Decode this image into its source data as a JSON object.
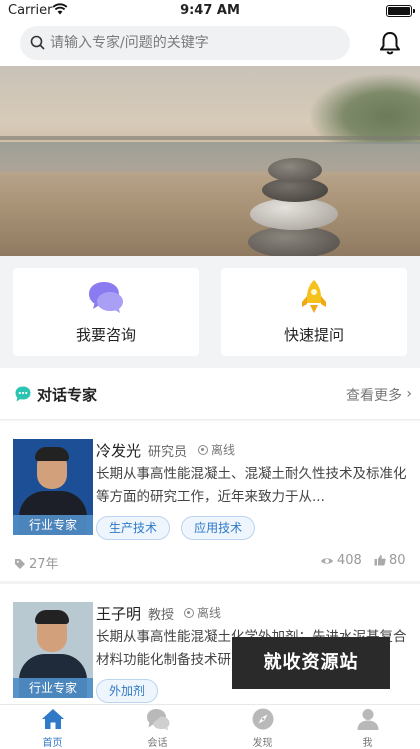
{
  "status_bar": {
    "carrier": "Carrier",
    "time": "9:47 AM"
  },
  "search": {
    "placeholder": "请输入专家/问题的关键字"
  },
  "banner": {
    "active_slide": 1
  },
  "actions": [
    {
      "label": "我要咨询",
      "icon": "chat-bubbles-icon"
    },
    {
      "label": "快速提问",
      "icon": "rocket-icon"
    }
  ],
  "section": {
    "title": "对话专家",
    "more_label": "查看更多"
  },
  "experts": [
    {
      "name": "冷发光",
      "rank": "研究员",
      "status": "离线",
      "description": "长期从事高性能混凝土、混凝土耐久性技术及标准化等方面的研究工作，近年来致力于从...",
      "photo_tag": "行业专家",
      "tags": [
        "生产技术",
        "应用技术"
      ],
      "years": "27年",
      "views": "408",
      "likes": "80"
    },
    {
      "name": "王子明",
      "rank": "教授",
      "status": "离线",
      "description": "长期从事高性能混凝土化学外加剂；先进水泥基复合材料功能化制备技术研究...",
      "photo_tag": "行业专家",
      "tags": [
        "外加剂"
      ]
    }
  ],
  "watermark": "就收资源站",
  "tabbar": [
    {
      "label": "首页",
      "icon": "home-icon",
      "active": true
    },
    {
      "label": "会话",
      "icon": "chat-icon",
      "active": false
    },
    {
      "label": "发现",
      "icon": "compass-icon",
      "active": false
    },
    {
      "label": "我",
      "icon": "user-icon",
      "active": false
    }
  ],
  "colors": {
    "accent": "#2f79c7",
    "chip_bg": "#eef5fd",
    "icon_purple": "#8a7cf0",
    "icon_yellow": "#f5c21b"
  }
}
